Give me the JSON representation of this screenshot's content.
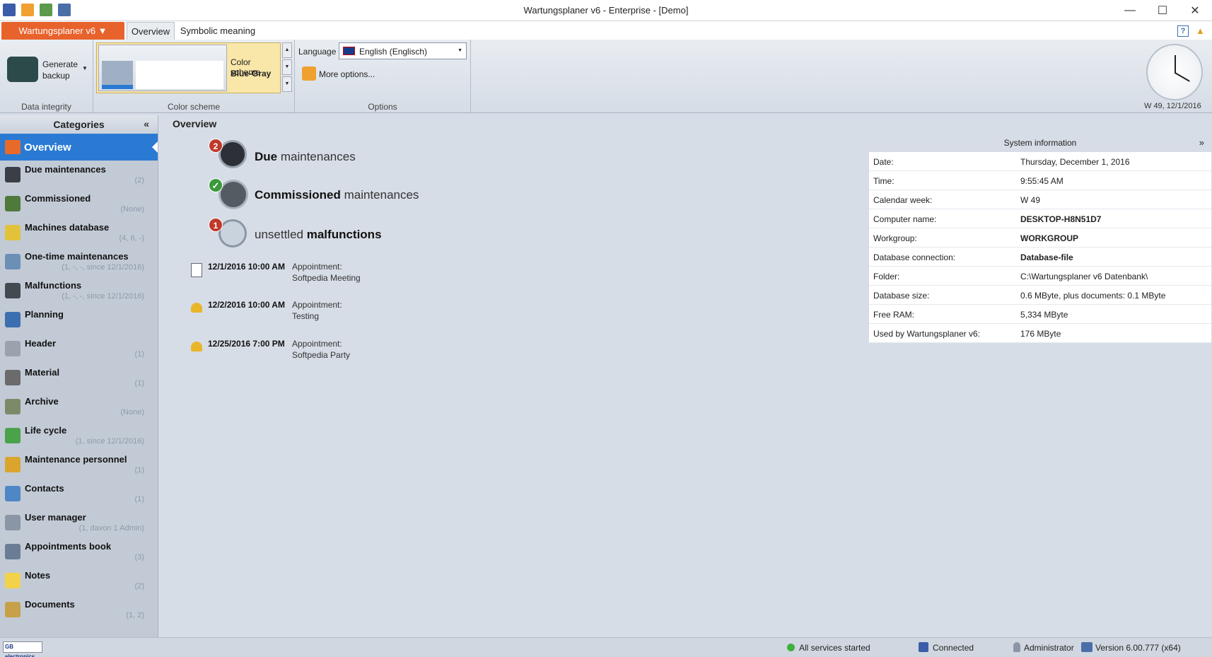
{
  "window": {
    "title": "Wartungsplaner v6 - Enterprise - [Demo]"
  },
  "tabs": {
    "app": "Wartungsplaner v6 ▼",
    "overview": "Overview",
    "symbolic": "Symbolic meaning"
  },
  "ribbon": {
    "backup_label1": "Generate",
    "backup_label2": "backup",
    "data_integrity": "Data integrity",
    "scheme_label": "Color scheme",
    "scheme_value": "Blue-Gray",
    "color_scheme_group": "Color scheme",
    "language_label": "Language",
    "language_value": "English (Englisch)",
    "more_options": "More options...",
    "options_group": "Options",
    "clock_text": "W 49, 12/1/2016"
  },
  "sidebar": {
    "title": "Categories",
    "selected": "Overview",
    "items": [
      {
        "label": "Due maintenances",
        "count": "(2)"
      },
      {
        "label": "Commissioned",
        "count": "(None)"
      },
      {
        "label": "Machines database",
        "count": "(4, 6, -)"
      },
      {
        "label": "One-time maintenances",
        "count": "(1, -, -, since 12/1/2016)"
      },
      {
        "label": "Malfunctions",
        "count": "(1, -, -, since 12/1/2016)"
      },
      {
        "label": "Planning",
        "count": ""
      },
      {
        "label": "Header",
        "count": "(1)"
      },
      {
        "label": "Material",
        "count": "(1)"
      },
      {
        "label": "Archive",
        "count": "(None)"
      },
      {
        "label": "Life cycle",
        "count": "(1, since 12/1/2016)"
      },
      {
        "label": "Maintenance personnel",
        "count": "(1)"
      },
      {
        "label": "Contacts",
        "count": "(1)"
      },
      {
        "label": "User manager",
        "count": "(1, davon 1 Admin)"
      },
      {
        "label": "Appointments book",
        "count": "(3)"
      },
      {
        "label": "Notes",
        "count": "(2)"
      },
      {
        "label": "Documents",
        "count": "(1, 2)"
      }
    ],
    "icon_colors": [
      "#3a3f47",
      "#4f7a3c",
      "#e2c23a",
      "#6b8fb5",
      "#444a52",
      "#3c6fb0",
      "#9aa3ad",
      "#6b6b6b",
      "#7d8a6a",
      "#4aa34a",
      "#d9a52c",
      "#4f86c6",
      "#8a96a5",
      "#6b7c95",
      "#f3d24b",
      "#c7a14a"
    ]
  },
  "main": {
    "heading": "Overview",
    "due_count": "2",
    "due_bold": "Due",
    "due_rest": "maintenances",
    "comm_bold": "Commissioned",
    "comm_rest": "maintenances",
    "malf_count": "1",
    "malf_pre": "unsettled",
    "malf_bold": "malfunctions",
    "appointments": [
      {
        "date": "12/1/2016 10:00 AM",
        "type": "Appointment:",
        "text": "Softpedia Meeting"
      },
      {
        "date": "12/2/2016 10:00 AM",
        "type": "Appointment:",
        "text": "Testing"
      },
      {
        "date": "12/25/2016 7:00 PM",
        "type": "Appointment:",
        "text": "Softpedia Party"
      }
    ]
  },
  "sysinfo": {
    "title": "System information",
    "rows": [
      {
        "k": "Date:",
        "v": "Thursday, December 1, 2016"
      },
      {
        "k": "Time:",
        "v": "9:55:45 AM"
      },
      {
        "k": "Calendar week:",
        "v": "W 49"
      },
      {
        "k": "Computer name:",
        "v": "DESKTOP-H8N51D7"
      },
      {
        "k": "Workgroup:",
        "v": "WORKGROUP"
      },
      {
        "k": "Database connection:",
        "v": "Database-file"
      },
      {
        "k": "Folder:",
        "v": "C:\\Wartungsplaner v6 Datenbank\\"
      },
      {
        "k": "Database size:",
        "v": "0.6 MByte, plus documents: 0.1 MByte"
      },
      {
        "k": "Free RAM:",
        "v": "5,334 MByte"
      },
      {
        "k": "Used by Wartungsplaner v6:",
        "v": "176 MByte"
      }
    ]
  },
  "status": {
    "logo": "GB electronics",
    "services": "All services started",
    "connected": "Connected",
    "user": "Administrator",
    "version": "Version 6.00.777 (x64)"
  },
  "colors": {
    "accent": "#2a7ad4",
    "apptab": "#e8622c",
    "badge_red": "#c0392b",
    "badge_green": "#3a9a3a"
  }
}
